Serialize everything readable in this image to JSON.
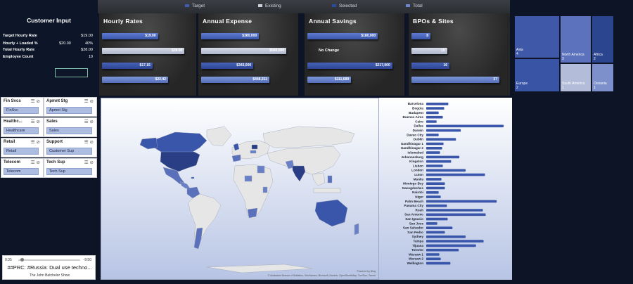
{
  "customer_input": {
    "title": "Customer Input",
    "rows": [
      {
        "label": "Target Hourly Rate",
        "mid": "",
        "value": "$19.00"
      },
      {
        "label": "Hourly + Loaded %",
        "mid": "$20.00",
        "value": "40%"
      },
      {
        "label": "Total Hourly Rate",
        "mid": "",
        "value": "$28.00"
      },
      {
        "label": "Employee Count",
        "mid": "",
        "value": "10"
      }
    ]
  },
  "legend": [
    {
      "label": "Target",
      "color": "#3f5db3"
    },
    {
      "label": "Existing",
      "color": "#c9cfdd"
    },
    {
      "label": "Selected",
      "color": "#2e4aa0"
    },
    {
      "label": "Total",
      "color": "#6e87cc"
    }
  ],
  "panels": [
    {
      "title": "Hourly Rates",
      "bars": [
        {
          "label": "$19.00",
          "value": 19.0,
          "kind": "target"
        },
        {
          "label": "$28.00",
          "value": 28.0,
          "kind": "existing"
        },
        {
          "label": "$17.15",
          "value": 17.15,
          "kind": "selected"
        },
        {
          "label": "$22.42",
          "value": 22.42,
          "kind": "total"
        }
      ],
      "max": 29.6
    },
    {
      "title": "Annual Expense",
      "bars": [
        {
          "label": "$380,000",
          "value": 380000,
          "kind": "target"
        },
        {
          "label": "$560,000",
          "value": 560000,
          "kind": "existing"
        },
        {
          "label": "$343,000",
          "value": 343000,
          "kind": "selected"
        },
        {
          "label": "$448,311",
          "value": 448311,
          "kind": "total"
        }
      ],
      "max": 592000
    },
    {
      "title": "Annual Savings",
      "bars": [
        {
          "label": "$180,000",
          "value": 180000,
          "kind": "target"
        },
        {
          "label": "",
          "value": 0,
          "kind": "existing",
          "note": "No Change"
        },
        {
          "label": "$217,000",
          "value": 217000,
          "kind": "selected"
        },
        {
          "label": "$111,689",
          "value": 111689,
          "kind": "total"
        }
      ],
      "max": 230000
    },
    {
      "title": "BPOs & Sites",
      "bars": [
        {
          "label": "8",
          "value": 8,
          "kind": "target"
        },
        {
          "label": "15",
          "value": 15,
          "kind": "existing"
        },
        {
          "label": "16",
          "value": 16,
          "kind": "selected"
        },
        {
          "label": "37",
          "value": 37,
          "kind": "total"
        }
      ],
      "max": 38.5
    }
  ],
  "treemap": [
    {
      "name": "Asia",
      "value": "4",
      "color": "#3f58a8"
    },
    {
      "name": "Europe",
      "value": "2",
      "color": "#3a54a5"
    },
    {
      "name": "North America",
      "value": "3",
      "color": "#5c72bd"
    },
    {
      "name": "Africa",
      "value": "2",
      "color": "#2c458f"
    },
    {
      "name": "South America",
      "value": "1",
      "color": "#b3bdd9"
    },
    {
      "name": "Oceania",
      "value": "1",
      "color": "#7e90cb"
    }
  ],
  "slicers": [
    {
      "title": "Fin Svcs",
      "item": "FinSvc"
    },
    {
      "title": "Apmnt Stg",
      "item": "Apmnt Stg"
    },
    {
      "title": "Healthc...",
      "item": "Healthcare"
    },
    {
      "title": "Sales",
      "item": "Sales"
    },
    {
      "title": "Retail",
      "item": "Retail"
    },
    {
      "title": "Support",
      "item": "Customer Sup"
    },
    {
      "title": "Telecom",
      "item": "Telecom"
    },
    {
      "title": "Tech Sup",
      "item": "Tech Sup"
    }
  ],
  "map": {
    "credit_top": "Powered by Bing",
    "credit": "© Australian Bureau of Statistics, GeoNames, Microsoft, Navinfo, OpenStreetMap, TomTom, Zenrin"
  },
  "chart_data": {
    "type": "bar",
    "title": "",
    "categories": [
      "Barcelona",
      "Bogota",
      "Budapest",
      "Buenos Aires",
      "Cairo",
      "Dallas",
      "Darwin",
      "Davao City",
      "Dublin",
      "Gandhinagar 1",
      "Gandhinagar 2",
      "Islamabad",
      "Johannesburg",
      "Kingston",
      "Lisbon",
      "London",
      "Luton",
      "Manila",
      "Montego Bay",
      "Nacogdoches",
      "Nairobi",
      "Niger",
      "Palm Beach",
      "Panama City",
      "Rosh",
      "San Antonio",
      "San Ignacio",
      "San Jose",
      "San Salvador",
      "San Pedro",
      "Sydney",
      "Tampa",
      "Tijuana",
      "Toronto",
      "Warsaw 1",
      "Warsaw 2",
      "Wellington"
    ],
    "values": [
      32,
      26,
      18,
      24,
      15,
      112,
      50,
      18,
      43,
      25,
      23,
      20,
      48,
      36,
      24,
      57,
      85,
      22,
      27,
      27,
      18,
      21,
      102,
      30,
      82,
      86,
      31,
      16,
      38,
      27,
      57,
      83,
      72,
      47,
      19,
      21,
      35
    ],
    "xlim": [
      0,
      115
    ]
  },
  "media": {
    "elapsed": "0:35",
    "remaining": "-9:50",
    "progress": 0.06,
    "title": "##PRC: #Russia: Dual use techno...",
    "show": "The John Batchelor Show"
  }
}
